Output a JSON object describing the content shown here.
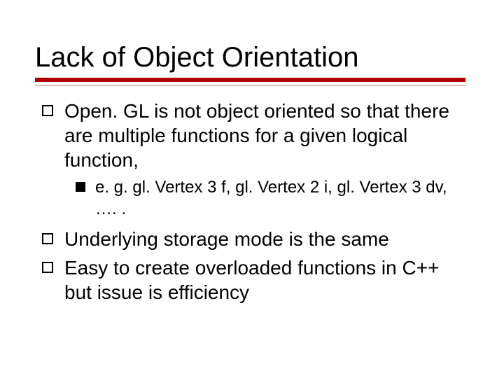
{
  "slide": {
    "title": "Lack of Object Orientation",
    "bullets": [
      {
        "level": 1,
        "text": "Open. GL is not object oriented so that there are multiple functions for a given logical function,"
      },
      {
        "level": 2,
        "text": "e. g. gl. Vertex 3 f, gl. Vertex 2 i, gl. Vertex 3 dv, …. ."
      },
      {
        "level": 1,
        "text": "Underlying storage mode is the same"
      },
      {
        "level": 1,
        "text": "Easy to create overloaded functions in C++ but issue is efficiency"
      }
    ]
  }
}
